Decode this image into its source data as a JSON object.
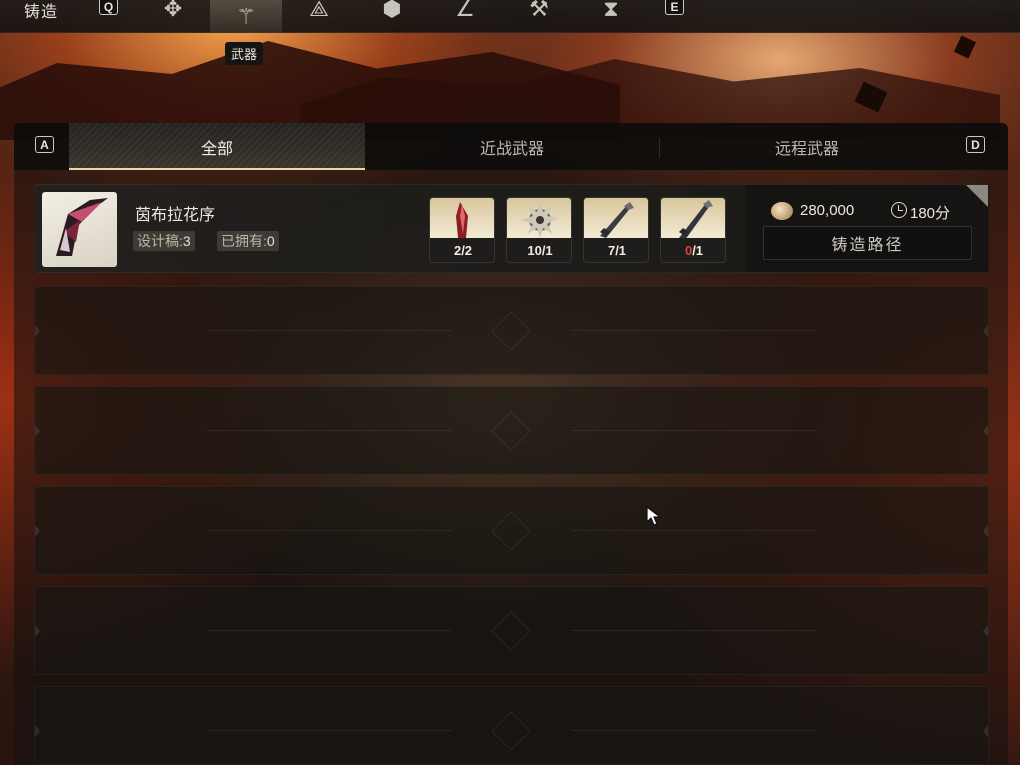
{
  "header": {
    "title": "铸造",
    "prev_key": "Q",
    "next_key": "E",
    "category_icons": [
      {
        "name": "quatrefoil-icon",
        "glyph": "✥"
      },
      {
        "name": "weapon-category-icon",
        "glyph": "⚚",
        "active": true
      },
      {
        "name": "triangle-knot-icon",
        "glyph": "⟁"
      },
      {
        "name": "cube-icon",
        "glyph": "⬢"
      },
      {
        "name": "angle-icon",
        "glyph": "∠"
      },
      {
        "name": "hammer-icon",
        "glyph": "⚒"
      },
      {
        "name": "hourglass-icon",
        "glyph": "⧗"
      }
    ],
    "active_tooltip": "武器"
  },
  "tabs": {
    "left_key": "A",
    "right_key": "D",
    "items": [
      {
        "label": "全部",
        "active": true
      },
      {
        "label": "近战武器",
        "active": false
      },
      {
        "label": "远程武器",
        "active": false
      }
    ]
  },
  "recipe": {
    "name": "茵布拉花序",
    "design_label": "设计稿:",
    "design_count": "3",
    "owned_label": "已拥有:",
    "owned_count": "0",
    "materials": [
      {
        "name": "crystal-shard",
        "have": "2",
        "need": "/2",
        "sufficient": true
      },
      {
        "name": "gear-core",
        "have": "10",
        "need": "/1",
        "sufficient": true
      },
      {
        "name": "blade-part-a",
        "have": "7",
        "need": "/1",
        "sufficient": true
      },
      {
        "name": "blade-part-b",
        "have": "0",
        "need": "/1",
        "sufficient": false
      }
    ],
    "cost": "280,000",
    "time": "180分",
    "route_button": "铸造路径"
  },
  "empty_slots": 5,
  "colors": {
    "active_underline": "#e9d8a8",
    "insufficient": "#e0423a"
  }
}
